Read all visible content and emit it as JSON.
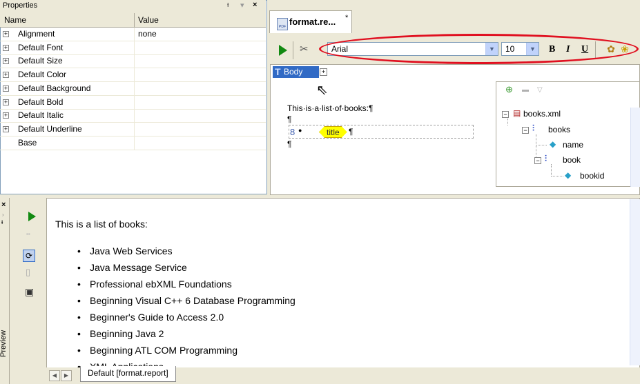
{
  "properties": {
    "title": "Properties",
    "controls": {
      "pin": "ᵻ",
      "dropdown": "▾",
      "close": "×"
    },
    "columns": [
      "Name",
      "Value"
    ],
    "rows": [
      {
        "name": "Alignment",
        "value": "none",
        "expandable": true
      },
      {
        "name": "Default Font",
        "value": "",
        "expandable": true
      },
      {
        "name": "Default Size",
        "value": "",
        "expandable": true
      },
      {
        "name": "Default Color",
        "value": "",
        "expandable": true
      },
      {
        "name": "Default Background",
        "value": "",
        "expandable": true
      },
      {
        "name": "Default Bold",
        "value": "",
        "expandable": true
      },
      {
        "name": "Default Italic",
        "value": "",
        "expandable": true
      },
      {
        "name": "Default Underline",
        "value": "",
        "expandable": true
      },
      {
        "name": "Base",
        "value": "",
        "expandable": false
      }
    ]
  },
  "document_tab": {
    "label": "format.re...",
    "modified_marker": "*",
    "icon_text": "PDF"
  },
  "toolbar": {
    "font": "Arial",
    "size": "10",
    "bold": "B",
    "italic": "I",
    "underline": "U",
    "highlight_color": "#e01020"
  },
  "editor": {
    "body_tag": "Body",
    "body_icon": "T",
    "text_line": "This·is·a·list·of·books:¶",
    "pilcrow": "¶",
    "title_field": "title",
    "field_bullet": "●"
  },
  "tree": {
    "root": "books.xml",
    "nodes": [
      {
        "label": "books"
      },
      {
        "label": "name"
      },
      {
        "label": "book"
      },
      {
        "label": "bookid"
      }
    ]
  },
  "preview": {
    "heading": "This is a list of books:",
    "items": [
      "Java Web Services",
      "Java Message Service",
      "Professional ebXML Foundations",
      "Beginning Visual C++ 6 Database Programming",
      "Beginner's Guide to Access 2.0",
      "Beginning Java 2",
      "Beginning ATL COM Programming",
      "XML Applications"
    ],
    "side_label": "Preview",
    "tab_label": "Default [format.report]"
  }
}
